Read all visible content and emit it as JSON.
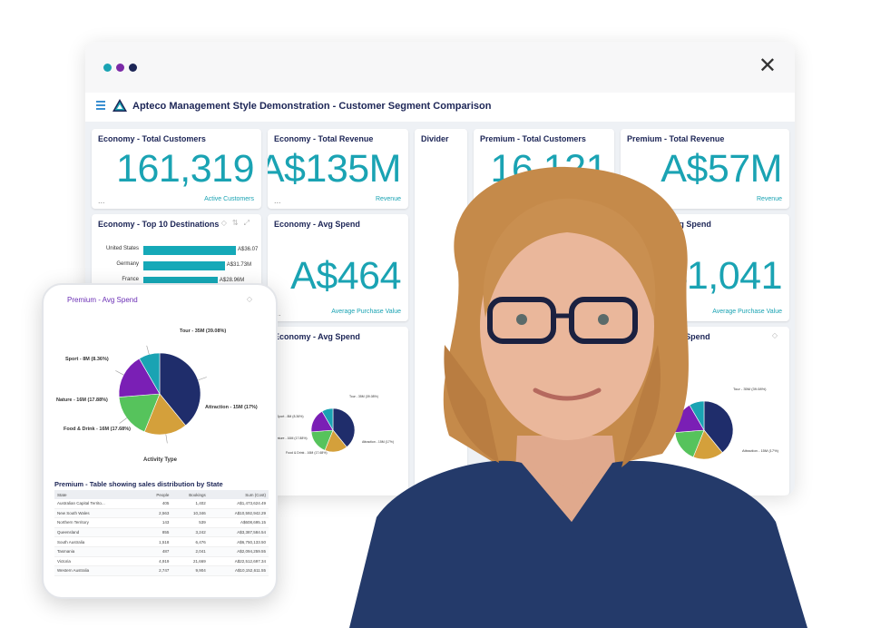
{
  "window": {
    "dots": [
      "#1aa3b3",
      "#7b2aa7",
      "#1c2556"
    ],
    "close_symbol": "✕"
  },
  "app": {
    "title": "Apteco Management Style Demonstration - Customer Segment Comparison",
    "logo_text": "APTECO"
  },
  "cards": {
    "economy_total_customers": {
      "title": "Economy - Total Customers",
      "value": "161,319",
      "caption": "Active Customers"
    },
    "economy_total_revenue": {
      "title": "Economy - Total Revenue",
      "value": "A$135M",
      "caption": "Revenue"
    },
    "divider": {
      "title": "Divider"
    },
    "premium_total_customers": {
      "title": "Premium - Total Customers",
      "value": "16,121"
    },
    "premium_total_revenue": {
      "title": "Premium - Total Revenue",
      "value": "A$57M",
      "caption": "Revenue"
    },
    "economy_top10": {
      "title": "Economy - Top 10 Destinations",
      "rows": [
        {
          "label": "United States",
          "value": 36.07,
          "text": "A$36.07"
        },
        {
          "label": "Germany",
          "value": 31.73,
          "text": "A$31.73M"
        },
        {
          "label": "France",
          "value": 28.96,
          "text": "A$28.96M"
        }
      ]
    },
    "economy_avg_spend": {
      "title": "Economy - Avg Spend",
      "value": "A$464",
      "caption": "Average Purchase Value"
    },
    "premium_avg_spend": {
      "title": "Premium - Avg Spend",
      "value": "A$1,041",
      "caption": "Average Purchase Value"
    },
    "economy_avg_spend_pie": {
      "title": "Economy - Avg Spend"
    },
    "premium_avg_spend_pie": {
      "title": "Avg Spend"
    },
    "ellipsis": "..."
  },
  "tablet": {
    "chart_title": "Premium - Avg Spend",
    "x_label": "Activity Type",
    "table_title": "Premium - Table showing sales distribution by State",
    "columns": [
      "State",
      "People",
      "Bookings",
      "Sum (Cost)"
    ],
    "rows": [
      [
        "Australian Capital Territo...",
        "405",
        "1,402",
        "A$1,473,624.49"
      ],
      [
        "New South Wales",
        "2,563",
        "10,346",
        "A$10,592,942.29"
      ],
      [
        "Northern Territory",
        "143",
        "539",
        "A$608,695.15"
      ],
      [
        "Queensland",
        "855",
        "3,242",
        "A$3,387,584.54"
      ],
      [
        "South Australia",
        "1,518",
        "6,476",
        "A$6,750,133.50"
      ],
      [
        "Tasmania",
        "487",
        "2,041",
        "A$2,094,259.55"
      ],
      [
        "Victoria",
        "4,919",
        "21,669",
        "A$22,512,697.34"
      ],
      [
        "Western Australia",
        "2,747",
        "9,904",
        "A$10,152,611.55"
      ]
    ]
  },
  "chart_data": {
    "type": "pie",
    "title": "Premium - Avg Spend",
    "xlabel": "Activity Type",
    "slices": [
      {
        "label": "Tour - 35M (39.08%)",
        "value": 39.08,
        "color": "#1f2d6b"
      },
      {
        "label": "Attraction - 15M (17%)",
        "value": 17.0,
        "color": "#d4a03b"
      },
      {
        "label": "Food & Drink - 16M (17.68%)",
        "value": 17.68,
        "color": "#56c35c"
      },
      {
        "label": "Nature - 16M (17.88%)",
        "value": 17.88,
        "color": "#7a1fb5"
      },
      {
        "label": "Sport - 8M (8.36%)",
        "value": 8.36,
        "color": "#1aa3b3"
      }
    ]
  }
}
